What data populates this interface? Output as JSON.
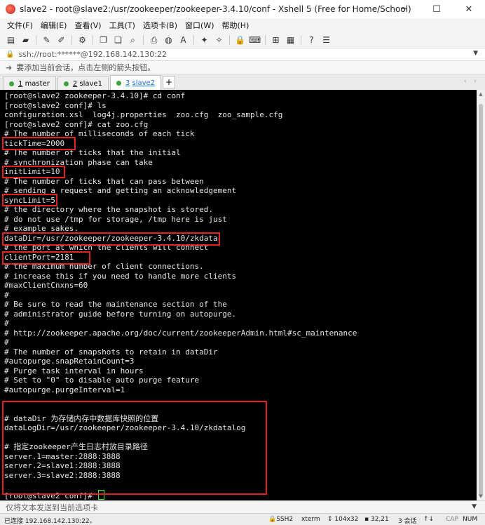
{
  "window": {
    "title": "slave2 - root@slave2:/usr/zookeeper/zookeeper-3.4.10/conf - Xshell 5 (Free for Home/School)",
    "controls": [
      "─",
      "☐",
      "✕"
    ]
  },
  "menu": [
    "文件(F)",
    "编辑(E)",
    "查看(V)",
    "工具(T)",
    "选项卡(B)",
    "窗口(W)",
    "帮助(H)"
  ],
  "address": {
    "text": "ssh://root:******@192.168.142.130:22"
  },
  "hint": {
    "text": "要添加当前会话，点击左侧的箭头按钮。"
  },
  "tabs": [
    {
      "num": "1",
      "name": "master",
      "active": false
    },
    {
      "num": "2",
      "name": "slave1",
      "active": false
    },
    {
      "num": "3",
      "name": "slave2",
      "active": true
    }
  ],
  "tab_add": "+",
  "terminal": {
    "lines": [
      "[root@slave2 zookeeper-3.4.10]# cd conf",
      "[root@slave2 conf]# ls",
      "configuration.xsl  log4j.properties  zoo.cfg  zoo_sample.cfg",
      "[root@slave2 conf]# cat zoo.cfg",
      "# The number of milliseconds of each tick",
      "tickTime=2000",
      "# The number of ticks that the initial",
      "# synchronization phase can take",
      "initLimit=10",
      "# The number of ticks that can pass between",
      "# sending a request and getting an acknowledgement",
      "syncLimit=5",
      "# the directory where the snapshot is stored.",
      "# do not use /tmp for storage, /tmp here is just",
      "# example sakes.",
      "dataDir=/usr/zookeeper/zookeeper-3.4.10/zkdata",
      "# the port at which the clients will connect",
      "clientPort=2181",
      "# the maximum number of client connections.",
      "# increase this if you need to handle more clients",
      "#maxClientCnxns=60",
      "#",
      "# Be sure to read the maintenance section of the",
      "# administrator guide before turning on autopurge.",
      "#",
      "# http://zookeeper.apache.org/doc/current/zookeeperAdmin.html#sc_maintenance",
      "#",
      "# The number of snapshots to retain in dataDir",
      "#autopurge.snapRetainCount=3",
      "# Purge task interval in hours",
      "# Set to \"0\" to disable auto purge feature",
      "#autopurge.purgeInterval=1",
      "",
      "",
      "# dataDir 为存储内存中数据库快照的位置",
      "dataLogDir=/usr/zookeeper/zookeeper-3.4.10/zkdatalog",
      "",
      "# 指定zookeeper产生日志村放目录路径",
      "server.1=master:2888:3888",
      "server.2=slave1:2888:3888",
      "server.3=slave2:2888:3888",
      "",
      "[root@slave2 conf]# "
    ]
  },
  "sendbar": {
    "text": "仅将文本发送到当前选项卡"
  },
  "status": {
    "connection": "已连接 192.168.142.130:22。",
    "protocol": "SSH2",
    "terminal_type": "xterm",
    "size": "104x32",
    "cursor_pos": "32,21",
    "sessions": "3 会话",
    "caps": "CAP",
    "num": "NUM"
  },
  "colors": {
    "terminal_bg": "#000000",
    "terminal_fg": "#e6e6e6",
    "highlight": "#e02424",
    "cursor": "#33ff33",
    "tab_dot": "#3aa53a"
  }
}
